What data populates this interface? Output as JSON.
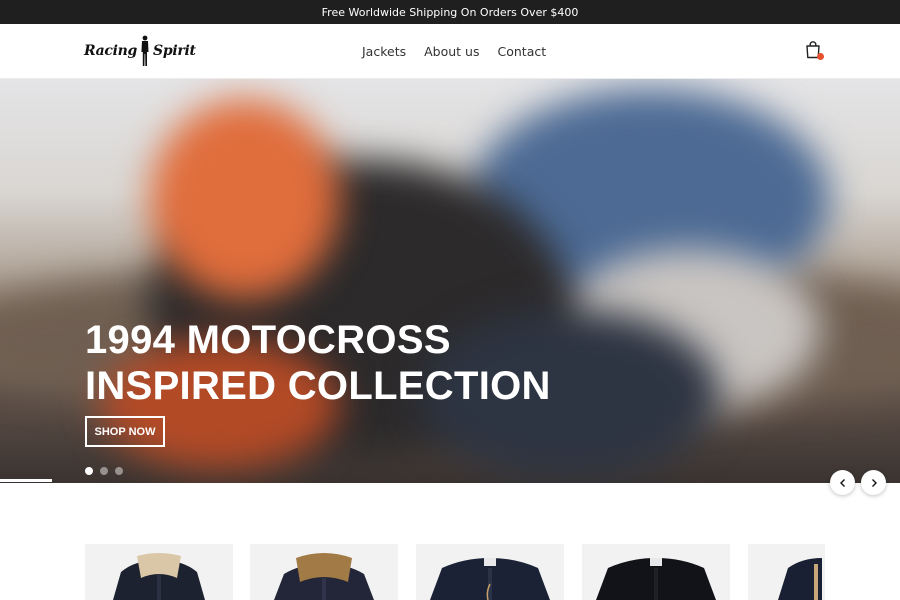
{
  "announcement": {
    "text": "Free Worldwide Shipping On Orders Over $400"
  },
  "header": {
    "logo": {
      "word_left": "Racing",
      "word_right": "Spirit",
      "mark_icon": "rider-silhouette-icon"
    },
    "nav": [
      {
        "label": "Jackets"
      },
      {
        "label": "About us"
      },
      {
        "label": "Contact"
      }
    ],
    "cart": {
      "icon": "shopping-bag-icon",
      "badge_color": "#e5512d"
    }
  },
  "hero": {
    "title_line1": "1994 MOTOCROSS",
    "title_line2": "INSPIRED COLLECTION",
    "cta_label": "SHOP NOW",
    "slides_total": 3,
    "active_slide": 1,
    "prev_icon": "chevron-left-icon",
    "next_icon": "chevron-right-icon"
  },
  "products": [
    {
      "name": "",
      "image": "denim-jacket-sherpa-cream-collar"
    },
    {
      "name": "",
      "image": "denim-jacket-tan-shearling-collar"
    },
    {
      "name": "",
      "image": "denim-jacket-dark-with-hang-tag"
    },
    {
      "name": "",
      "image": "black-denim-jacket"
    },
    {
      "name": "",
      "image": "denim-jacket-partial"
    }
  ]
}
